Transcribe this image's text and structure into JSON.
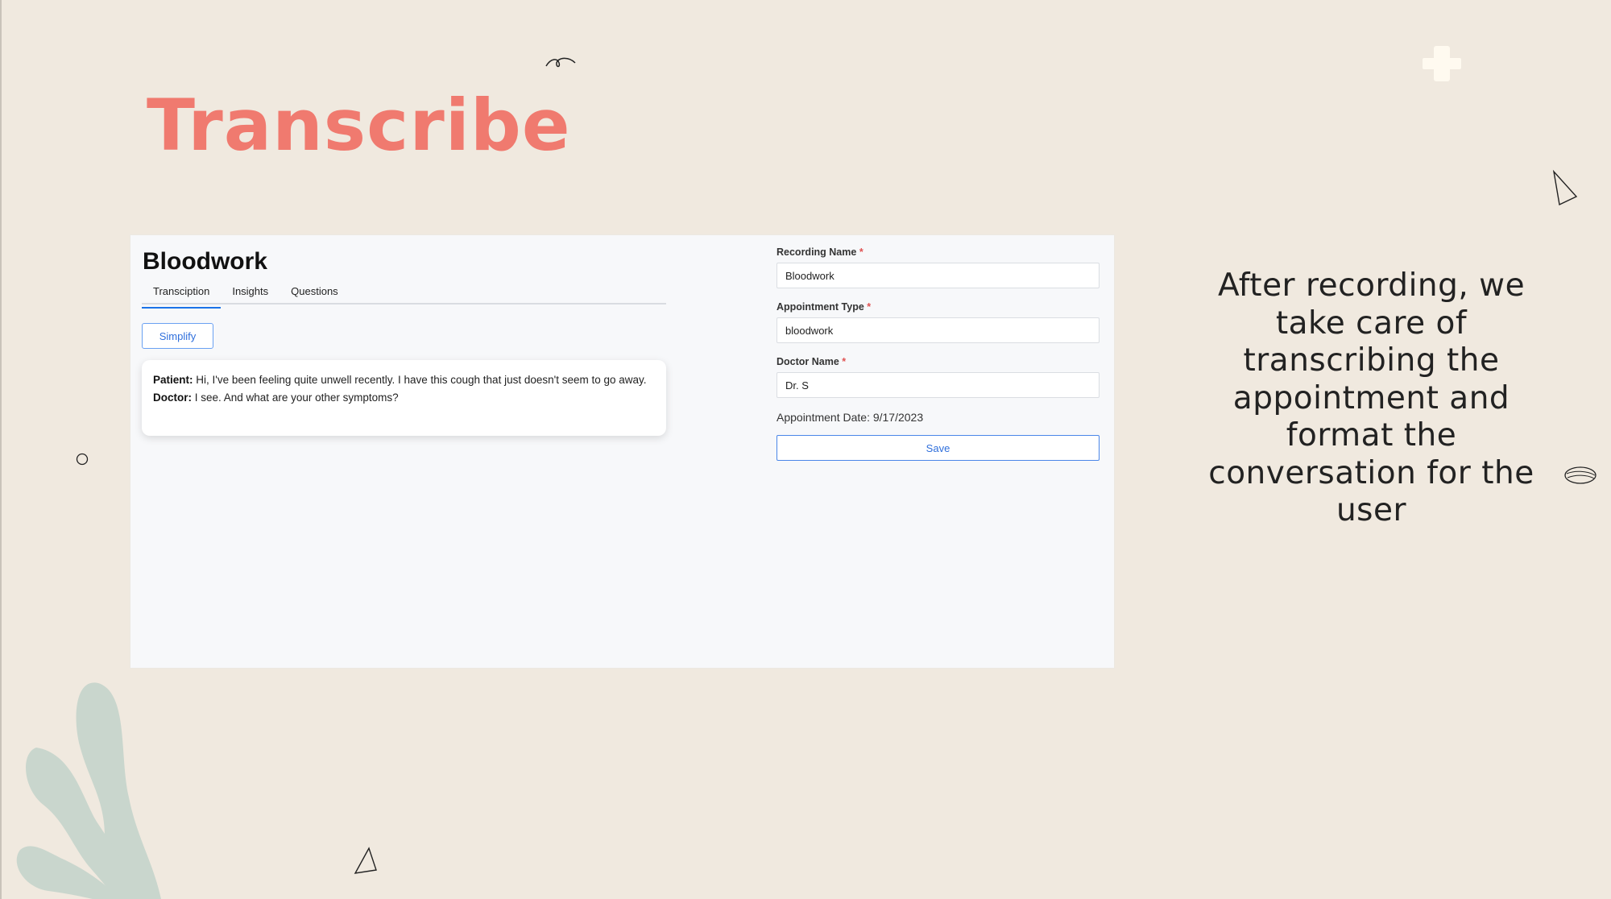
{
  "slide": {
    "title": "Transcribe",
    "caption": "After recording, we take care of transcribing the appointment and format the conversation for the user"
  },
  "app": {
    "heading": "Bloodwork",
    "tabs": [
      {
        "label": "Transciption",
        "active": true
      },
      {
        "label": "Insights",
        "active": false
      },
      {
        "label": "Questions",
        "active": false
      }
    ],
    "simplify_label": "Simplify",
    "transcript": [
      {
        "speaker": "Patient:",
        "text": " Hi, I've been feeling quite unwell recently. I have this cough that just doesn't seem to go away."
      },
      {
        "speaker": "Doctor:",
        "text": " I see. And what are your other symptoms?"
      }
    ],
    "form": {
      "recording_name_label": "Recording Name",
      "recording_name_value": "Bloodwork",
      "appointment_type_label": "Appointment Type",
      "appointment_type_value": "bloodwork",
      "doctor_name_label": "Doctor Name",
      "doctor_name_value": "Dr. S",
      "required_mark": "*",
      "appointment_date": "Appointment Date: 9/17/2023",
      "save_label": "Save"
    }
  },
  "colors": {
    "background": "#f0e9df",
    "title": "#f07a6f",
    "accent": "#1a73e8",
    "leaf": "#c9d6cd"
  },
  "icons": [
    "squiggle-icon",
    "plus-icon",
    "cone-icon",
    "circle-icon",
    "pill-icon",
    "leaf-icon"
  ]
}
